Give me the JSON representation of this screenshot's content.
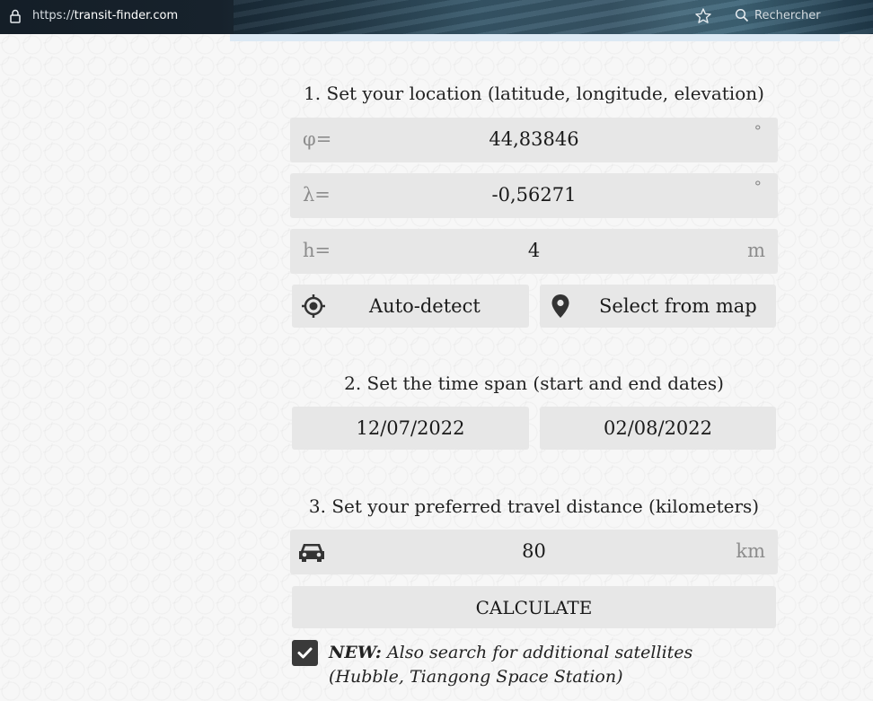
{
  "browser": {
    "url_scheme": "https://",
    "url_host": "transit-finder.com",
    "search_placeholder": "Rechercher"
  },
  "location": {
    "title": "1. Set your location (latitude, longitude, elevation)",
    "latitude": {
      "prefix": "φ=",
      "value": "44,83846",
      "unit": "°"
    },
    "longitude": {
      "prefix": "λ=",
      "value": "-0,56271",
      "unit": "°"
    },
    "elevation": {
      "prefix": "h=",
      "value": "4",
      "unit": "m"
    },
    "auto_detect_label": "Auto-detect",
    "select_map_label": "Select from map"
  },
  "timespan": {
    "title": "2. Set the time span (start and end dates)",
    "start_date": "12/07/2022",
    "end_date": "02/08/2022"
  },
  "distance": {
    "title": "3. Set your preferred travel distance (kilometers)",
    "value": "80",
    "unit": "km"
  },
  "calculate_label": "CALCULATE",
  "satellites_option": {
    "checked": true,
    "new_label": "NEW:",
    "text": " Also search for additional satellites (Hubble, Tiangong Space Station)"
  },
  "colors": {
    "field_bg": "#e7e7e7",
    "page_bg": "#f7f7f7",
    "checkbox_bg": "#3a3a3a"
  }
}
